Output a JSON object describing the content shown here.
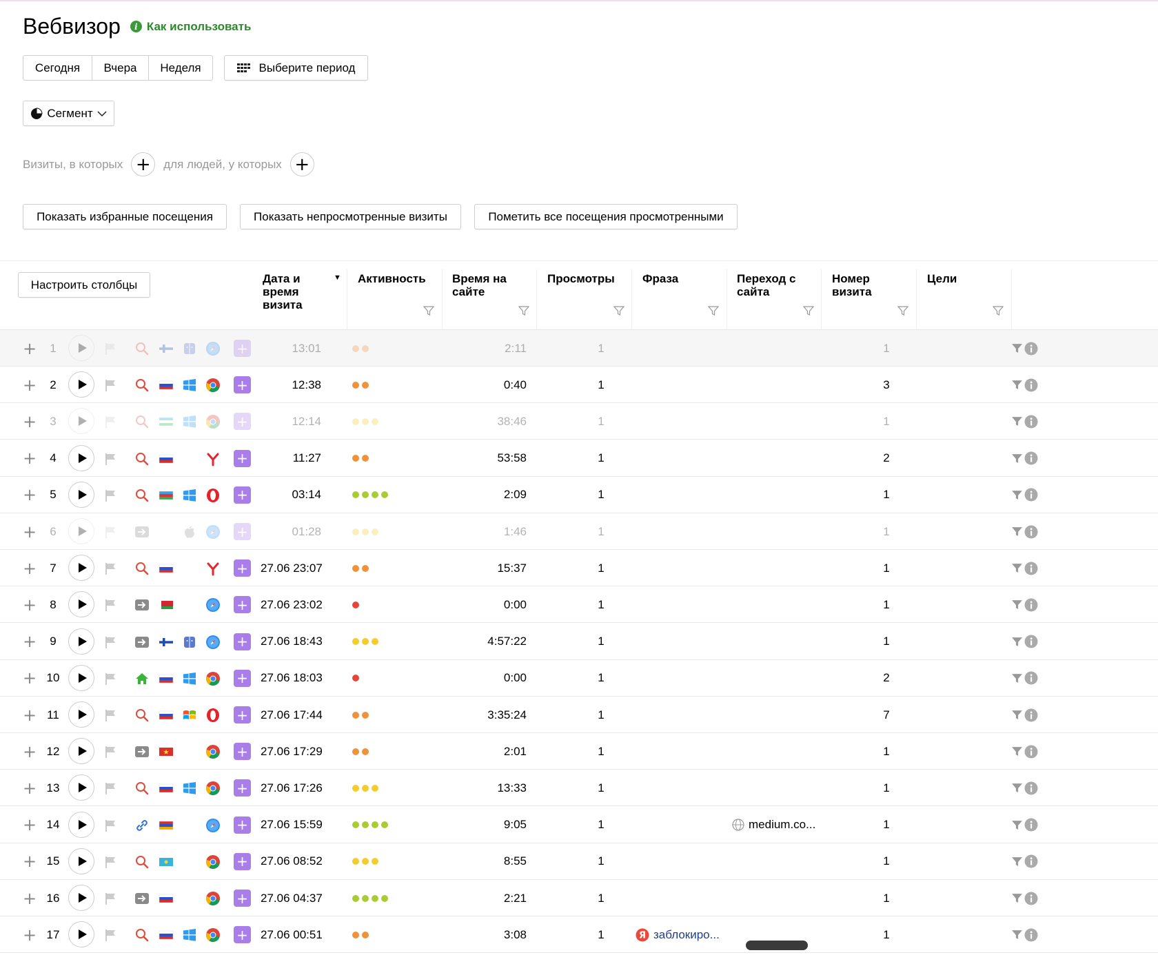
{
  "header": {
    "title": "Вебвизор",
    "howto": "Как использовать"
  },
  "period": {
    "today": "Сегодня",
    "yesterday": "Вчера",
    "week": "Неделя",
    "choose": "Выберите период"
  },
  "segment": {
    "label": "Сегмент"
  },
  "filters": {
    "visits": "Визиты, в которых",
    "people": "для людей, у которых"
  },
  "actions": {
    "favorites": "Показать избранные посещения",
    "unviewed": "Показать непросмотренные визиты",
    "mark_all": "Пометить все посещения просмотренными"
  },
  "table": {
    "configure": "Настроить столбцы",
    "columns": {
      "date": "Дата и время визита",
      "activity": "Активность",
      "time_on_site": "Время на сайте",
      "views": "Просмотры",
      "phrase": "Фраза",
      "referer": "Переход с сайта",
      "visit_number": "Номер визита",
      "goals": "Цели"
    },
    "colors": {
      "orange": "#f0923a",
      "yellow": "#f5cc2e",
      "green": "#a9cc35",
      "red": "#e4473a",
      "purple": "#a97ee8"
    },
    "rows": [
      {
        "n": "1",
        "date": "13:01",
        "dots": [
          "orange",
          "orange"
        ],
        "time": "2:11",
        "views": "1",
        "phrase": "",
        "referer": "",
        "visit": "1",
        "faded": true,
        "grey": true,
        "source": "search",
        "flag": "fi",
        "os": "mac",
        "browser": "safari"
      },
      {
        "n": "2",
        "date": "12:38",
        "dots": [
          "orange",
          "orange"
        ],
        "time": "0:40",
        "views": "1",
        "phrase": "",
        "referer": "",
        "visit": "3",
        "faded": false,
        "source": "search",
        "flag": "ru",
        "os": "windows",
        "browser": "chrome"
      },
      {
        "n": "3",
        "date": "12:14",
        "dots": [
          "yellow",
          "yellow",
          "yellow"
        ],
        "time": "38:46",
        "views": "1",
        "phrase": "",
        "referer": "",
        "visit": "1",
        "faded": true,
        "source": "search",
        "flag": "uz",
        "os": "windows",
        "browser": "chrome"
      },
      {
        "n": "4",
        "date": "11:27",
        "dots": [
          "orange",
          "orange"
        ],
        "time": "53:58",
        "views": "1",
        "phrase": "",
        "referer": "",
        "visit": "2",
        "faded": false,
        "source": "search",
        "flag": "ru",
        "os": "",
        "browser": "yandex"
      },
      {
        "n": "5",
        "date": "03:14",
        "dots": [
          "green",
          "green",
          "green",
          "green"
        ],
        "time": "2:09",
        "views": "1",
        "phrase": "",
        "referer": "",
        "visit": "1",
        "faded": false,
        "source": "search",
        "flag": "az",
        "os": "windows",
        "browser": "opera"
      },
      {
        "n": "6",
        "date": "01:28",
        "dots": [
          "yellow",
          "yellow",
          "yellow"
        ],
        "time": "1:46",
        "views": "1",
        "phrase": "",
        "referer": "",
        "visit": "1",
        "faded": true,
        "source": "direct",
        "flag": "",
        "os": "apple",
        "browser": "safari"
      },
      {
        "n": "7",
        "date": "27.06 23:07",
        "dots": [
          "orange",
          "orange"
        ],
        "time": "15:37",
        "views": "1",
        "phrase": "",
        "referer": "",
        "visit": "1",
        "faded": false,
        "source": "search",
        "flag": "ru",
        "os": "",
        "browser": "yandex"
      },
      {
        "n": "8",
        "date": "27.06 23:02",
        "dots": [
          "red"
        ],
        "time": "0:00",
        "views": "1",
        "phrase": "",
        "referer": "",
        "visit": "1",
        "faded": false,
        "source": "direct",
        "flag": "by",
        "os": "",
        "browser": "safari"
      },
      {
        "n": "9",
        "date": "27.06 18:43",
        "dots": [
          "yellow",
          "yellow",
          "yellow"
        ],
        "time": "4:57:22",
        "views": "1",
        "phrase": "",
        "referer": "",
        "visit": "1",
        "faded": false,
        "source": "direct",
        "flag": "fi",
        "os": "mac",
        "browser": "safari"
      },
      {
        "n": "10",
        "date": "27.06 18:03",
        "dots": [
          "red"
        ],
        "time": "0:00",
        "views": "1",
        "phrase": "",
        "referer": "",
        "visit": "2",
        "faded": false,
        "source": "internal",
        "flag": "ru",
        "os": "windows",
        "browser": "chrome"
      },
      {
        "n": "11",
        "date": "27.06 17:44",
        "dots": [
          "orange",
          "orange"
        ],
        "time": "3:35:24",
        "views": "1",
        "phrase": "",
        "referer": "",
        "visit": "7",
        "faded": false,
        "source": "search",
        "flag": "ru",
        "os": "winxp",
        "browser": "opera"
      },
      {
        "n": "12",
        "date": "27.06 17:29",
        "dots": [
          "orange",
          "orange"
        ],
        "time": "2:01",
        "views": "1",
        "phrase": "",
        "referer": "",
        "visit": "1",
        "faded": false,
        "source": "direct",
        "flag": "vn",
        "os": "",
        "browser": "chrome"
      },
      {
        "n": "13",
        "date": "27.06 17:26",
        "dots": [
          "yellow",
          "yellow",
          "yellow"
        ],
        "time": "13:33",
        "views": "1",
        "phrase": "",
        "referer": "",
        "visit": "1",
        "faded": false,
        "source": "search",
        "flag": "ru",
        "os": "windows",
        "browser": "chrome"
      },
      {
        "n": "14",
        "date": "27.06 15:59",
        "dots": [
          "green",
          "green",
          "green",
          "green"
        ],
        "time": "9:05",
        "views": "1",
        "phrase": "",
        "referer": "medium.co...",
        "visit": "1",
        "faded": false,
        "source": "link",
        "flag": "am",
        "os": "",
        "browser": "safari"
      },
      {
        "n": "15",
        "date": "27.06 08:52",
        "dots": [
          "yellow",
          "yellow",
          "yellow"
        ],
        "time": "8:55",
        "views": "1",
        "phrase": "",
        "referer": "",
        "visit": "1",
        "faded": false,
        "source": "search",
        "flag": "kz",
        "os": "",
        "browser": "chrome"
      },
      {
        "n": "16",
        "date": "27.06 04:37",
        "dots": [
          "green",
          "green",
          "green",
          "green"
        ],
        "time": "2:21",
        "views": "1",
        "phrase": "",
        "referer": "",
        "visit": "1",
        "faded": false,
        "source": "direct",
        "flag": "ru",
        "os": "",
        "browser": "chrome"
      },
      {
        "n": "17",
        "date": "27.06 00:51",
        "dots": [
          "orange",
          "orange"
        ],
        "time": "3:08",
        "views": "1",
        "phrase": "заблокиро...",
        "referer": "",
        "visit": "1",
        "faded": false,
        "source": "search",
        "flag": "ru",
        "os": "windows",
        "browser": "chrome"
      }
    ]
  }
}
